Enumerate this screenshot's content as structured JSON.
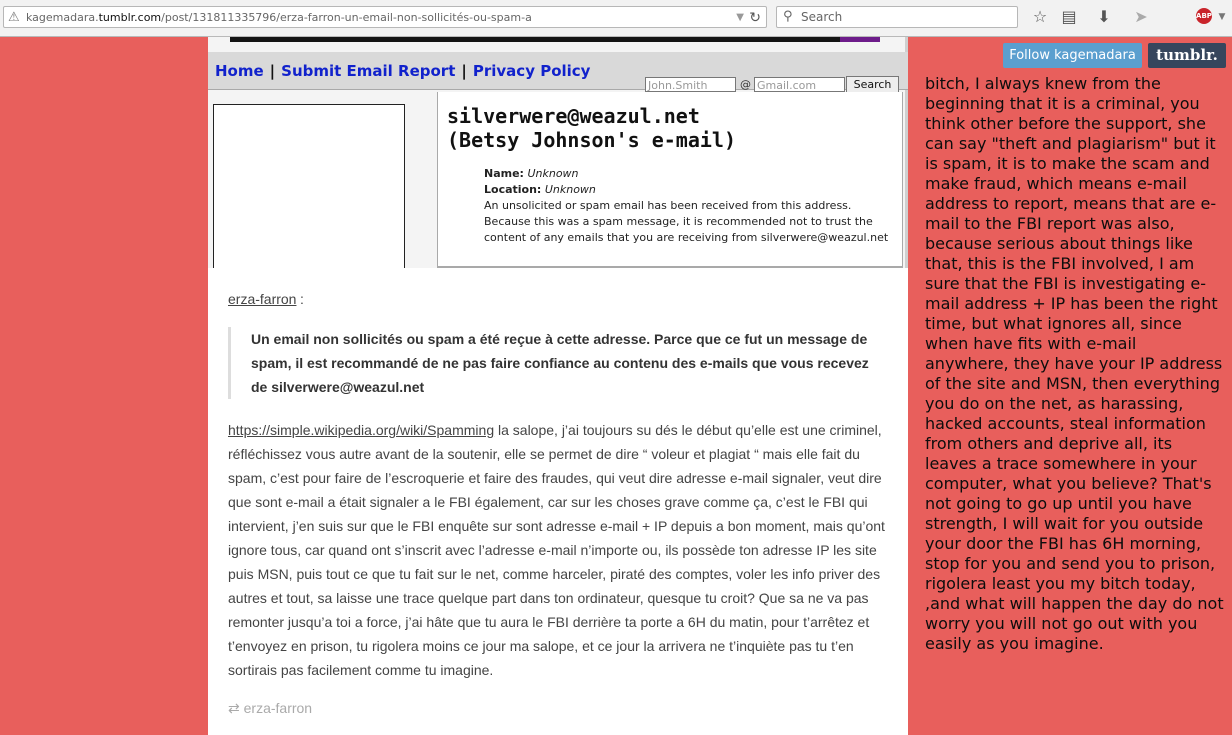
{
  "browser": {
    "url_prefix": "kagemadara.",
    "url_domain": "tumblr.com",
    "url_path": "/post/131811335796/erza-farron-un-email-non-sollicités-ou-spam-a",
    "search_placeholder": "Search"
  },
  "embed": {
    "nav": {
      "home": "Home",
      "separator": "|",
      "submit": "Submit Email Report",
      "privacy": "Privacy Policy"
    },
    "name_placeholder": "John.Smith",
    "at_sign": "@",
    "domain_placeholder": "Gmail.com",
    "search_button": "Search",
    "email_line1": "silverwere@weazul.net",
    "email_line2": "(Betsy Johnson's e-mail)",
    "name_label": "Name:",
    "name_value": "Unknown",
    "location_label": "Location:",
    "location_value": "Unknown",
    "description": "An unsolicited or spam email has been received from this address. Because this was a spam message, it is recommended not to trust the content of any emails that you are receiving from silverwere@weazul.net"
  },
  "post": {
    "source_user": "erza-farron",
    "colon": ":",
    "quote": "Un email non sollicités ou spam a été reçue à cette adresse. Parce que ce fut un message de spam, il est recommandé de ne pas faire confiance au contenu des e-mails que vous recevez de silverwere@weazul.net",
    "link": "https://simple.wikipedia.org/wiki/Spamming",
    "body": " la salope, j’ai toujours su dés le début qu’elle est une criminel, réfléchissez vous autre avant de la soutenir, elle se permet de dire “ voleur et plagiat “ mais elle fait du spam, c’est pour faire de l’escroquerie et faire des fraudes, qui veut dire adresse e-mail signaler, veut dire que sont e-mail a était signaler a le FBI également, car sur les choses grave comme ça, c’est le FBI qui intervient, j’en suis sur que le FBI enquête sur sont adresse e-mail + IP depuis a bon moment, mais qu’ont ignore tous, car quand ont s’inscrit avec l’adresse e-mail n’importe ou, ils possède ton adresse IP les site puis MSN, puis tout ce que tu fait sur le net, comme harceler, piraté des comptes, voler les info priver des autres et tout, sa laisse une trace quelque part dans ton ordinateur, quesque tu croit? Que sa ne va pas remonter jusqu’a toi a force, j’ai hâte que tu aura le FBI derrière ta porte a 6H du matin, pour t’arrêtez et t’envoyez en prison, tu rigolera moins ce jour ma salope, et ce jour la arrivera ne t’inquiète pas tu t’en sortirais pas facilement comme tu imagine.",
    "reblog_user": "erza-farron"
  },
  "sidebar": {
    "follow_button": "Follow kagemadara",
    "tumblr_button": "tumblr.",
    "translation": "bitch, I always knew from the beginning that it is a criminal, you think other before the support, she can say \"theft and plagiarism\" but it is spam, it is to make the scam and make fraud, which means e-mail address to report, means that are e-mail to the FBI report was also, because serious about things like that, this is the FBI involved, I am sure that the FBI is investigating e-mail address + IP has been the right time, but what ignores all, since when have fits with e-mail anywhere, they have your IP address of the site and MSN, then everything you do on the net, as harassing, hacked accounts, steal information from others and deprive all, its leaves a trace somewhere in your computer, what you believe? That's not going to go up until you have strength, I will wait for you outside your door the FBI has 6H morning, stop for you and send you to prison, rigolera least you my bitch today, ,and what will happen the day do not worry you will not go out with you easily as you imagine."
  },
  "icons": [
    "warning-icon",
    "dropdown-icon",
    "reload-icon",
    "search-icon",
    "star-icon",
    "reading-list-icon",
    "download-icon",
    "send-icon",
    "adblock-icon",
    "menu-icon",
    "reblog-icon"
  ],
  "colors": {
    "page_bg": "#e85f5c",
    "follow_btn": "#5b9fcf",
    "tumblr_btn": "#36465d",
    "nav_link": "#1122cc"
  }
}
